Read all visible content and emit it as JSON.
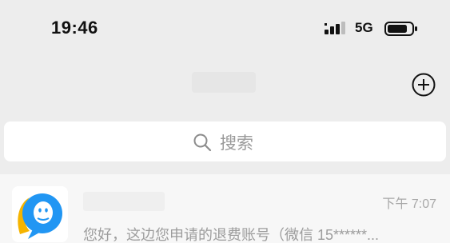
{
  "status_bar": {
    "time": "19:46",
    "network": "5G",
    "signal_icon": "signal-bars-icon",
    "battery_icon": "battery-icon"
  },
  "nav": {
    "add_icon": "plus-circle-icon"
  },
  "search": {
    "placeholder": "搜索",
    "icon": "search-icon"
  },
  "chats": [
    {
      "time": "下午 7:07",
      "preview": "您好，这边您申请的退费账号（微信 15******..."
    }
  ],
  "colors": {
    "background": "#ededed",
    "card": "#ffffff",
    "avatar_blue": "#2196f3",
    "avatar_yellow": "#f5b400"
  }
}
